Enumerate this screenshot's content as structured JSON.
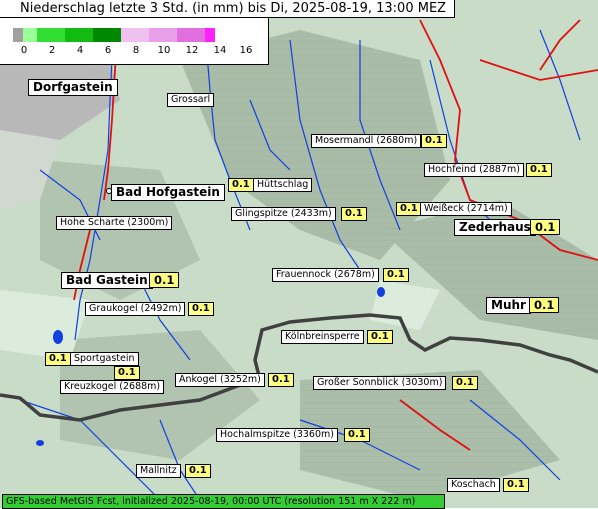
{
  "title": "Niederschlag letzte 3 Std. (in mm) bis Di, 2025-08-19, 13:00 MEZ",
  "legend": {
    "ticks": [
      "0",
      "2",
      "4",
      "6",
      "8",
      "10",
      "12",
      "14",
      "16"
    ],
    "colors": [
      "#a0a0a0",
      "#99ff99",
      "#33dd33",
      "#11bb11",
      "#008800",
      "#f0c0f0",
      "#e8a0e8",
      "#e070e0",
      "#ff20ff"
    ]
  },
  "places": {
    "dorfgastein": {
      "name": "Dorfgastein"
    },
    "grossarl": {
      "name": "Grossarl"
    },
    "mosermandl": {
      "name": "Mosermandl (2680m)",
      "value": "0.1"
    },
    "hochfeind": {
      "name": "Hochfeind (2887m)",
      "value": "0.1"
    },
    "bad_hofgastein": {
      "name": "Bad Hofgastein"
    },
    "huettschlag": {
      "name": "Hüttschlag",
      "value": "0.1"
    },
    "glingspitze": {
      "name": "Glingspitze (2433m)",
      "value": "0.1"
    },
    "weisseck": {
      "name": "Weißeck (2714m)",
      "value": "0.1"
    },
    "hohe_scharte": {
      "name": "Hohe Scharte (2300m)"
    },
    "zederhaus": {
      "name": "Zederhaus",
      "value": "0.1"
    },
    "frauennock": {
      "name": "Frauennock (2678m)",
      "value": "0.1"
    },
    "bad_gastein": {
      "name": "Bad Gastein",
      "value": "0.1"
    },
    "graukogel": {
      "name": "Graukogel (2492m)",
      "value": "0.1"
    },
    "muhr": {
      "name": "Muhr",
      "value": "0.1"
    },
    "koelnbreinsperre": {
      "name": "Kölnbreinsperre",
      "value": "0.1"
    },
    "sportgastein": {
      "name": "Sportgastein",
      "value": "0.1"
    },
    "kreuzkogel": {
      "name": "Kreuzkogel (2688m)",
      "value": "0.1"
    },
    "ankogel": {
      "name": "Ankogel (3252m)",
      "value": "0.1"
    },
    "grosser_sonnblick": {
      "name": "Großer Sonnblick (3030m)",
      "value": "0.1"
    },
    "hochalmspitze": {
      "name": "Hochalmspitze (3360m)",
      "value": "0.1"
    },
    "mallnitz": {
      "name": "Mallnitz",
      "value": "0.1"
    },
    "koschach": {
      "name": "Koschach",
      "value": "0.1"
    }
  },
  "footer": "GFS-based MetGIS Fcst, initialized 2025-08-19, 00:00 UTC  (resolution 151 m X 222 m)"
}
